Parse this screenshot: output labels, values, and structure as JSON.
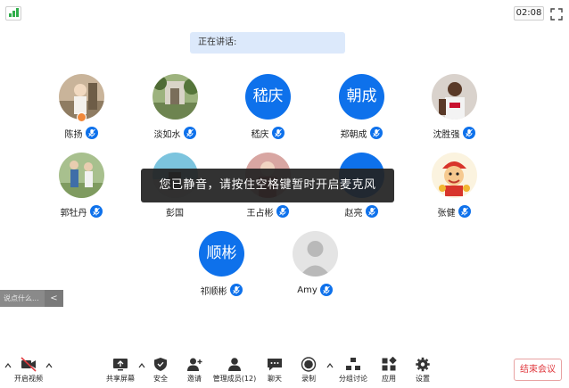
{
  "top_bar": {
    "timer": "02:08"
  },
  "speaking_label": "正在讲话:",
  "participants": [
    {
      "name": "陈扬",
      "avatar_type": "photo",
      "host": true
    },
    {
      "name": "淡如水",
      "avatar_type": "photo"
    },
    {
      "name": "嵇庆",
      "avatar_type": "text",
      "avatar_text": "嵇庆"
    },
    {
      "name": "郑朝成",
      "avatar_type": "text",
      "avatar_text": "朝成"
    },
    {
      "name": "沈胜强",
      "avatar_type": "photo"
    },
    {
      "name": "郭牡丹",
      "avatar_type": "photo"
    },
    {
      "name": "彭国",
      "avatar_type": "photo"
    },
    {
      "name": "王占彬",
      "avatar_type": "photo"
    },
    {
      "name": "赵亮",
      "avatar_type": "text",
      "avatar_text": ""
    },
    {
      "name": "张健",
      "avatar_type": "photo"
    },
    {
      "name": "祁顺彬",
      "avatar_type": "text",
      "avatar_text": "顺彬"
    },
    {
      "name": "Amy",
      "avatar_type": "default"
    }
  ],
  "toast": "您已静音，请按住空格键暂时开启麦克风",
  "chat": {
    "placeholder": "说点什么...",
    "toggle": "<"
  },
  "toolbar": {
    "start_video": "开启视频",
    "share_screen": "共享屏幕",
    "security": "安全",
    "invite": "邀请",
    "manage_participants": "管理成员(12)",
    "chat": "聊天",
    "record": "录制",
    "breakout": "分组讨论",
    "apps": "应用",
    "settings": "设置",
    "end_meeting": "结束会议"
  },
  "colors": {
    "accent": "#0e71eb",
    "end_meeting": "#e0393e",
    "speaking_bg": "#dce9fb",
    "signal": "#2fae4a"
  }
}
